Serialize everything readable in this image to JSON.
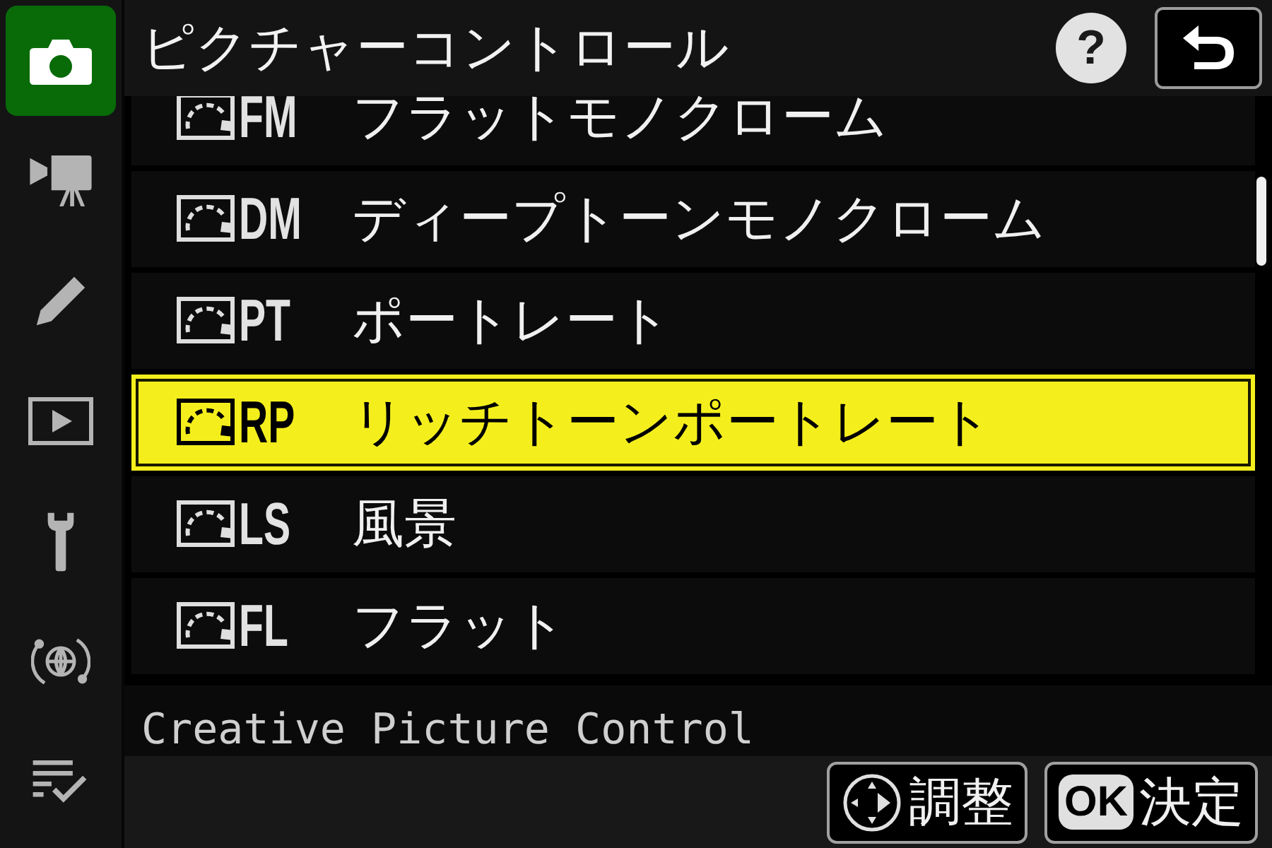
{
  "sidebar": {
    "tabs": [
      {
        "kind": "photo_shooting",
        "selected": true
      },
      {
        "kind": "movie_shooting",
        "selected": false
      },
      {
        "kind": "retouch",
        "selected": false
      },
      {
        "kind": "playback",
        "selected": false
      },
      {
        "kind": "setup",
        "selected": false
      },
      {
        "kind": "network",
        "selected": false
      },
      {
        "kind": "my_menu",
        "selected": false
      }
    ]
  },
  "header": {
    "title": "ピクチャーコントロール",
    "help_button": {
      "label": "?"
    }
  },
  "list": {
    "items": [
      {
        "code": "FM",
        "name": "フラットモノクローム",
        "selected": false
      },
      {
        "code": "DM",
        "name": "ディープトーンモノクローム",
        "selected": false
      },
      {
        "code": "PT",
        "name": "ポートレート",
        "selected": false
      },
      {
        "code": "RP",
        "name": "リッチトーンポートレート",
        "selected": true
      },
      {
        "code": "LS",
        "name": "風景",
        "selected": false
      },
      {
        "code": "FL",
        "name": "フラット",
        "selected": false
      }
    ]
  },
  "description": "Creative Picture Control",
  "footer": {
    "buttons": [
      {
        "kind": "dpad",
        "label": "調整"
      },
      {
        "kind": "ok",
        "badge": "OK",
        "label": "決定"
      }
    ]
  }
}
